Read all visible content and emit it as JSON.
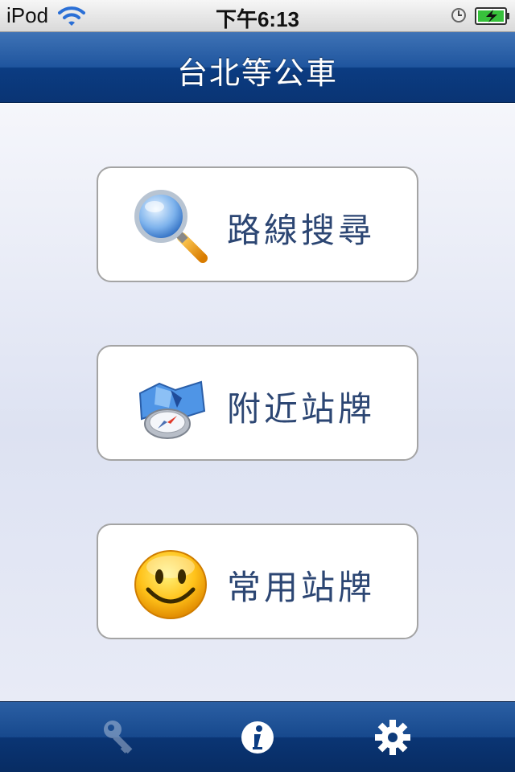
{
  "status_bar": {
    "carrier": "iPod",
    "time": "下午6:13",
    "wifi_icon": "wifi-icon",
    "clock_icon": "clock-icon",
    "battery_icon": "battery-charging-icon"
  },
  "nav_bar": {
    "title": "台北等公車"
  },
  "menu": {
    "items": [
      {
        "label": "路線搜尋",
        "icon": "magnifier-icon"
      },
      {
        "label": "附近站牌",
        "icon": "map-compass-icon"
      },
      {
        "label": "常用站牌",
        "icon": "smiley-icon"
      }
    ]
  },
  "tab_bar": {
    "items": [
      {
        "icon": "key-icon",
        "active": false
      },
      {
        "icon": "info-icon",
        "active": true
      },
      {
        "icon": "gear-icon",
        "active": true
      }
    ]
  },
  "colors": {
    "nav_blue": "#1f559e",
    "label_text": "#2c4673",
    "content_bg": "#dde2f2"
  }
}
